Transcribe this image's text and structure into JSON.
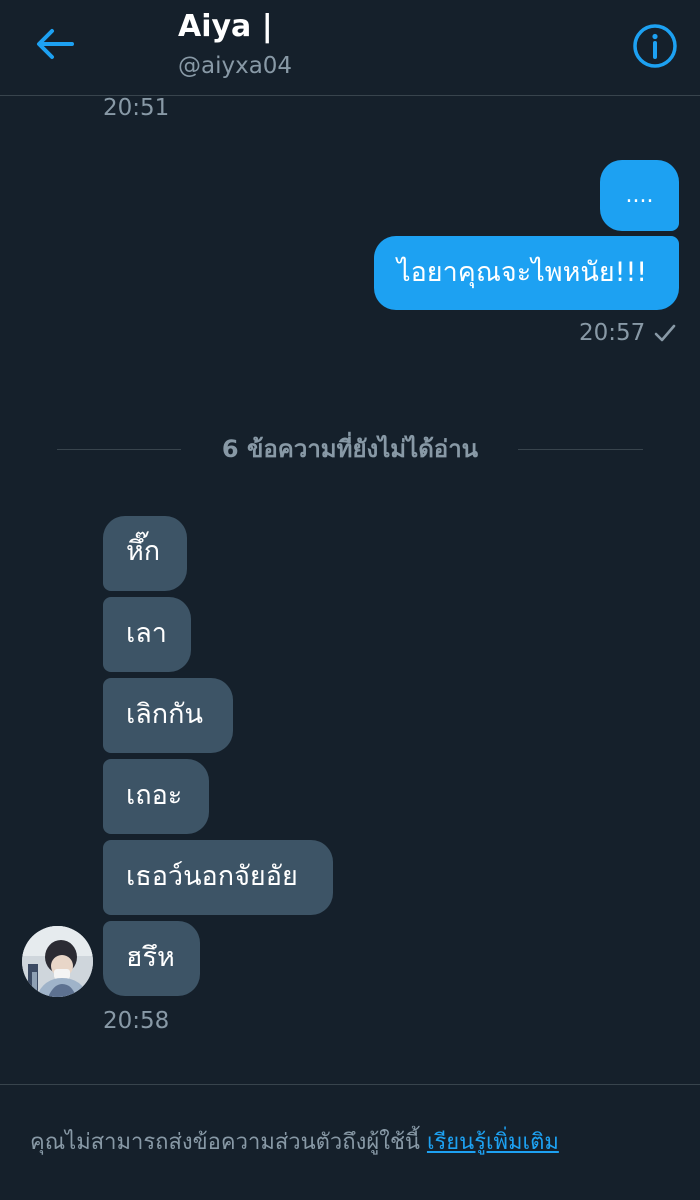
{
  "colors": {
    "background": "#15202b",
    "accent": "#1da1f2",
    "incoming_bubble": "#3d5466",
    "muted_text": "#8899a6",
    "divider": "#38444d"
  },
  "header": {
    "back_icon": "arrow-left-icon",
    "title": "Aiya |",
    "handle": "@aiyxa04",
    "info_icon": "info-circle-icon"
  },
  "conversation": {
    "top_timestamp": "20:51",
    "outgoing": {
      "messages": [
        "....",
        "ไอยาคุณจะไพหนัย!!!"
      ],
      "timestamp": "20:57",
      "status_icon": "checkmark-icon"
    },
    "unread_divider": "6 ข้อความที่ยังไม่ได้อ่าน",
    "incoming": {
      "messages": [
        "หึ๊ก",
        "เลา",
        "เลิกกัน",
        "เถอะ",
        "เธอว์นอกจัยอัย",
        "ฮรึห"
      ],
      "timestamp": "20:58",
      "avatar": "user-avatar"
    }
  },
  "footer": {
    "notice": "คุณไม่สามารถส่งข้อความส่วนตัวถึงผู้ใช้นี้ ",
    "learn_more": "เรียนรู้เพิ่มเติม"
  }
}
